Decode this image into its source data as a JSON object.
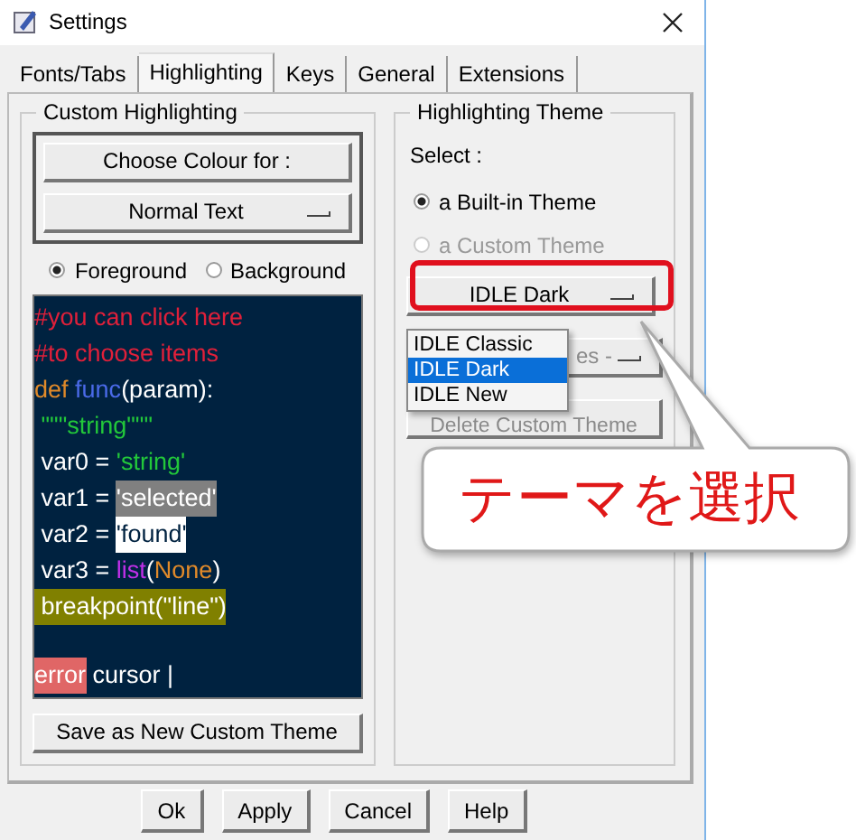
{
  "window": {
    "title": "Settings"
  },
  "tabs": [
    {
      "label": "Fonts/Tabs",
      "selected": false
    },
    {
      "label": "Highlighting",
      "selected": true
    },
    {
      "label": "Keys",
      "selected": false
    },
    {
      "label": "General",
      "selected": false
    },
    {
      "label": "Extensions",
      "selected": false
    }
  ],
  "custom_highlighting": {
    "title": "Custom Highlighting",
    "choose_button": "Choose Colour for :",
    "element_dropdown": "Normal Text",
    "radios": [
      {
        "label": "Foreground",
        "selected": true
      },
      {
        "label": "Background",
        "selected": false
      }
    ],
    "code_lines": [
      {
        "segments": [
          {
            "text": "#you can click here",
            "kind": "comment"
          }
        ]
      },
      {
        "segments": [
          {
            "text": "#to choose items",
            "kind": "comment"
          }
        ]
      },
      {
        "segments": [
          {
            "text": "def ",
            "kind": "keyword"
          },
          {
            "text": "func",
            "kind": "definition"
          },
          {
            "text": "(param):",
            "kind": "normal"
          }
        ]
      },
      {
        "segments": [
          {
            "text": " \"\"\"string\"\"\"",
            "kind": "string"
          }
        ]
      },
      {
        "segments": [
          {
            "text": " var0 = ",
            "kind": "normal"
          },
          {
            "text": "'string'",
            "kind": "string"
          }
        ]
      },
      {
        "segments": [
          {
            "text": " var1 = ",
            "kind": "normal"
          },
          {
            "text": "'selected'",
            "kind": "selected"
          }
        ]
      },
      {
        "segments": [
          {
            "text": " var2 = ",
            "kind": "normal"
          },
          {
            "text": "'found'",
            "kind": "found"
          }
        ]
      },
      {
        "segments": [
          {
            "text": " var3 = ",
            "kind": "normal"
          },
          {
            "text": "list",
            "kind": "builtin"
          },
          {
            "text": "(",
            "kind": "normal"
          },
          {
            "text": "None",
            "kind": "keyword"
          },
          {
            "text": ")",
            "kind": "normal"
          }
        ]
      },
      {
        "segments": [
          {
            "text": " breakpoint(\"line\")",
            "kind": "breakpoint"
          }
        ]
      },
      {
        "segments": [
          {
            "text": "error",
            "kind": "error"
          },
          {
            "text": " cursor |",
            "kind": "normal"
          }
        ]
      }
    ],
    "save_button": "Save as New Custom Theme"
  },
  "highlighting_theme": {
    "title": "Highlighting Theme",
    "select_label": "Select :",
    "radios": [
      {
        "label": "a Built-in Theme",
        "selected": true,
        "disabled": false
      },
      {
        "label": "a Custom Theme",
        "selected": false,
        "disabled": true
      }
    ],
    "theme_dropdown": "IDLE Dark",
    "dropdown_menu": [
      {
        "label": "IDLE Classic",
        "selected": false
      },
      {
        "label": "IDLE Dark",
        "selected": true
      },
      {
        "label": "IDLE New",
        "selected": false
      }
    ],
    "covered_buttons": [
      "es -",
      "Delete Custom Theme"
    ]
  },
  "callout": {
    "text": "テーマを選択"
  },
  "buttons": [
    "Ok",
    "Apply",
    "Cancel",
    "Help"
  ]
}
